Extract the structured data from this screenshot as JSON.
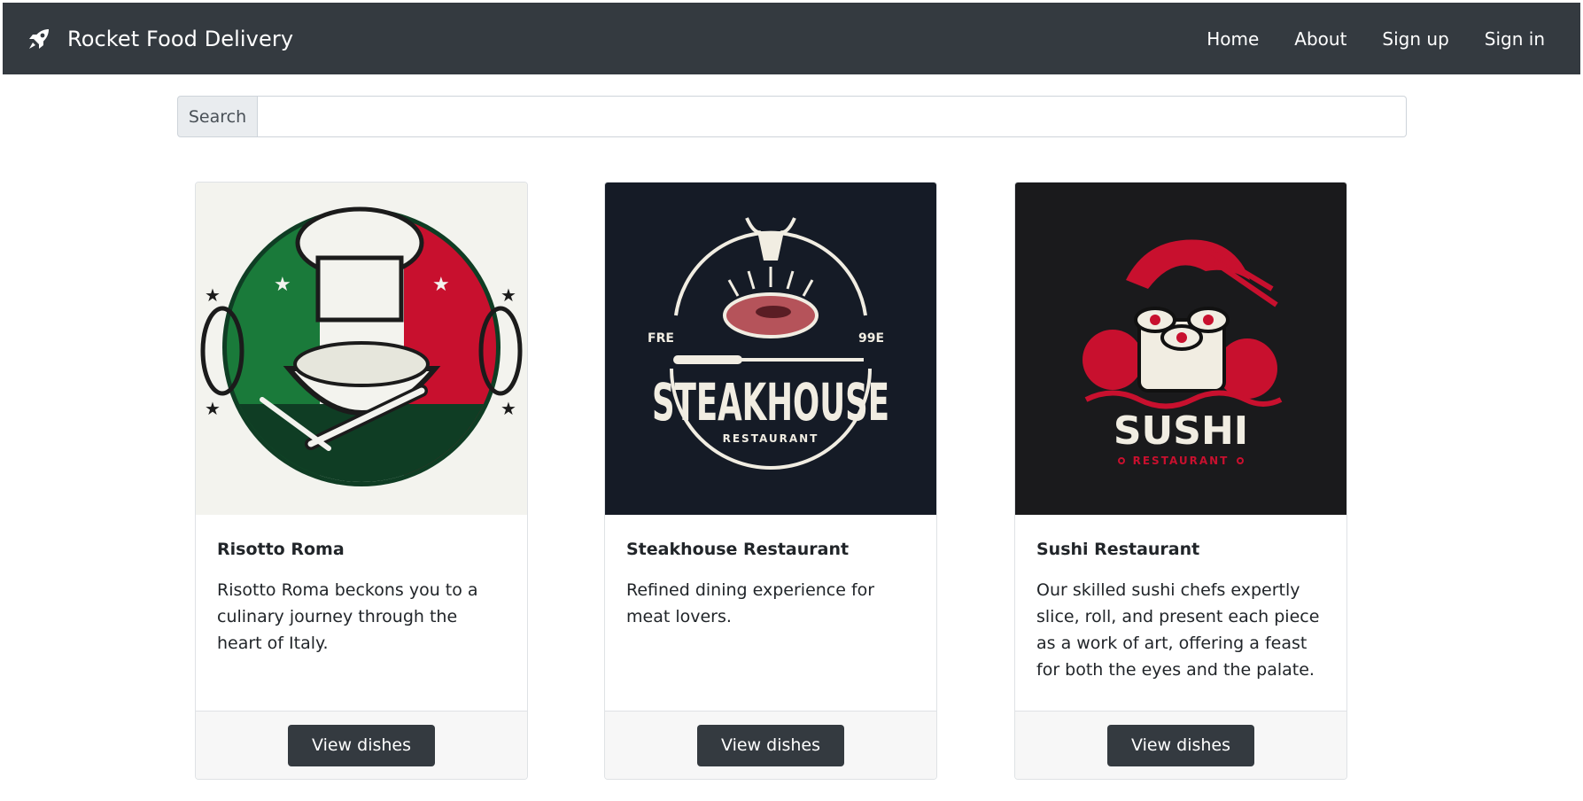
{
  "navbar": {
    "brand_icon": "rocket-icon",
    "brand": "Rocket Food Delivery",
    "links": [
      "Home",
      "About",
      "Sign up",
      "Sign in"
    ]
  },
  "search": {
    "label": "Search",
    "value": "",
    "placeholder": ""
  },
  "colors": {
    "navbar_bg": "#343a40",
    "button_bg": "#343a40",
    "footer_bg": "#f7f7f7"
  },
  "restaurants": [
    {
      "title": "Risotto Roma",
      "description": "Risotto Roma beckons you to a culinary journey through the heart of Italy.",
      "button": "View dishes",
      "logo": "risotto-roma-logo"
    },
    {
      "title": "Steakhouse Restaurant",
      "description": "Refined dining experience for meat lovers.",
      "button": "View dishes",
      "logo": "steakhouse-logo",
      "logo_text": {
        "main": "STEAKHOUSE",
        "sub": "RESTAURANT",
        "left": "FRE",
        "right": "99E"
      }
    },
    {
      "title": "Sushi Restaurant",
      "description": "Our skilled sushi chefs expertly slice, roll, and present each piece as a work of art, offering a feast for both the eyes and the palate.",
      "button": "View dishes",
      "logo": "sushi-logo",
      "logo_text": {
        "main": "SUSHI",
        "sub": "RESTAURANT"
      }
    }
  ]
}
